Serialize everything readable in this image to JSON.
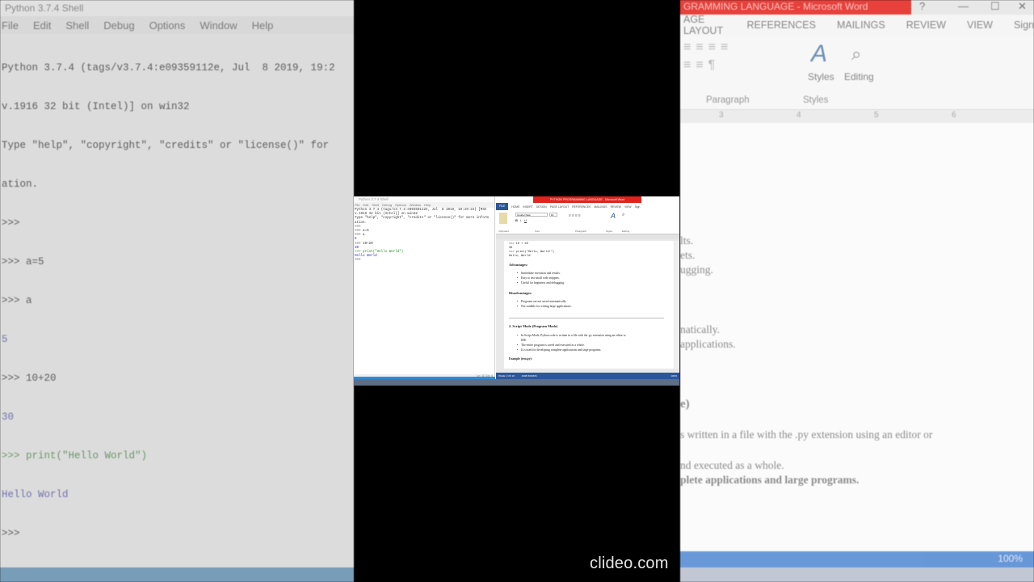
{
  "background_idle": {
    "title": "Python 3.7.4 Shell",
    "menu": [
      "File",
      "Edit",
      "Shell",
      "Debug",
      "Options",
      "Window",
      "Help"
    ],
    "lines": [
      "Python 3.7.4 (tags/v3.7.4:e09359112e, Jul  8 2019, 19:2",
      "v.1916 32 bit (Intel)] on win32",
      "Type \"help\", \"copyright\", \"credits\" or \"license()\" for",
      "ation.",
      ">>> ",
      ">>> a=5",
      ">>> a",
      "5",
      ">>> 10+20",
      "30",
      ">>> print(\"Hello World\")",
      "Hello World",
      ">>> "
    ]
  },
  "background_word": {
    "title": "GRAMMING LANGUAGE - Microsoft Word",
    "tabs": [
      "AGE LAYOUT",
      "REFERENCES",
      "MAILINGS",
      "REVIEW",
      "VIEW",
      "Sign"
    ],
    "group_paragraph": "Paragraph",
    "group_styles": "Styles",
    "styles_label": "Styles",
    "editing_label": "Editing",
    "ruler": [
      "3",
      "4",
      "5",
      "6"
    ],
    "doc_lines": [
      "lts.",
      "ets.",
      "ugging.",
      "natically.",
      "applications.",
      "e)",
      "s written in a file with the .py extension using an editor or",
      "nd executed as a whole.",
      "plete applications and large programs."
    ],
    "zoom": "100%"
  },
  "idle": {
    "title": "Python 3.7.4 Shell",
    "menu": [
      "File",
      "Edit",
      "Shell",
      "Debug",
      "Options",
      "Window",
      "Help"
    ],
    "lines": [
      "Python 3.7.4 (tags/v3.7.4:e09359112e, Jul  8 2019, 19:29:22) [MSC",
      "v.1916 32 bit (Intel)] on win32",
      "Type \"help\", \"copyright\", \"credits\" or \"license()\" for more inform",
      "ation.",
      ">>> ",
      ">>> a=5",
      ">>> a",
      "5",
      ">>> 10+20",
      "30",
      ">>> print(\"Hello World\")",
      "Hello World",
      ">>> "
    ],
    "status": "Ln: 11  Col: 4"
  },
  "word": {
    "title": "PYTHON PROGRAMMING LANGUAGE - Microsoft Word",
    "tabs": [
      "FILE",
      "HOME",
      "INSERT",
      "DESIGN",
      "PAGE LAYOUT",
      "REFERENCES",
      "MAILINGS",
      "REVIEW",
      "VIEW",
      "Sign"
    ],
    "font_name": "Courier New",
    "font_size": "10",
    "groups": [
      "Clipboard",
      "Font",
      "Paragraph",
      "Styles",
      "Editing"
    ],
    "doc": {
      "code1": ">>> 10 + 20",
      "code2": "30",
      "code3": ">>> print(\"Hello, World!\")",
      "code4": "Hello, World!",
      "adv_heading": "Advantages:",
      "adv": [
        "Immediate execution and results.",
        "Easy to test small code snippets.",
        "Useful for beginners and debugging."
      ],
      "dis_heading": "Disadvantages:",
      "dis": [
        "Programs are not saved automatically.",
        "Not suitable for writing large applications."
      ],
      "section_heading": "2. Script Mode (Program Mode)",
      "script": [
        "In Script Mode, Python code is written in a file with the .py extension using an editor or",
        "IDE.",
        "The entire program is saved and executed as a whole.",
        "It is used for developing complete applications and large programs."
      ],
      "example": "Example (test.py):"
    },
    "status_page": "PAGE 1 OF 10",
    "status_words": "1908 WORDS",
    "zoom": "100%"
  },
  "watermark": "clideo.com"
}
